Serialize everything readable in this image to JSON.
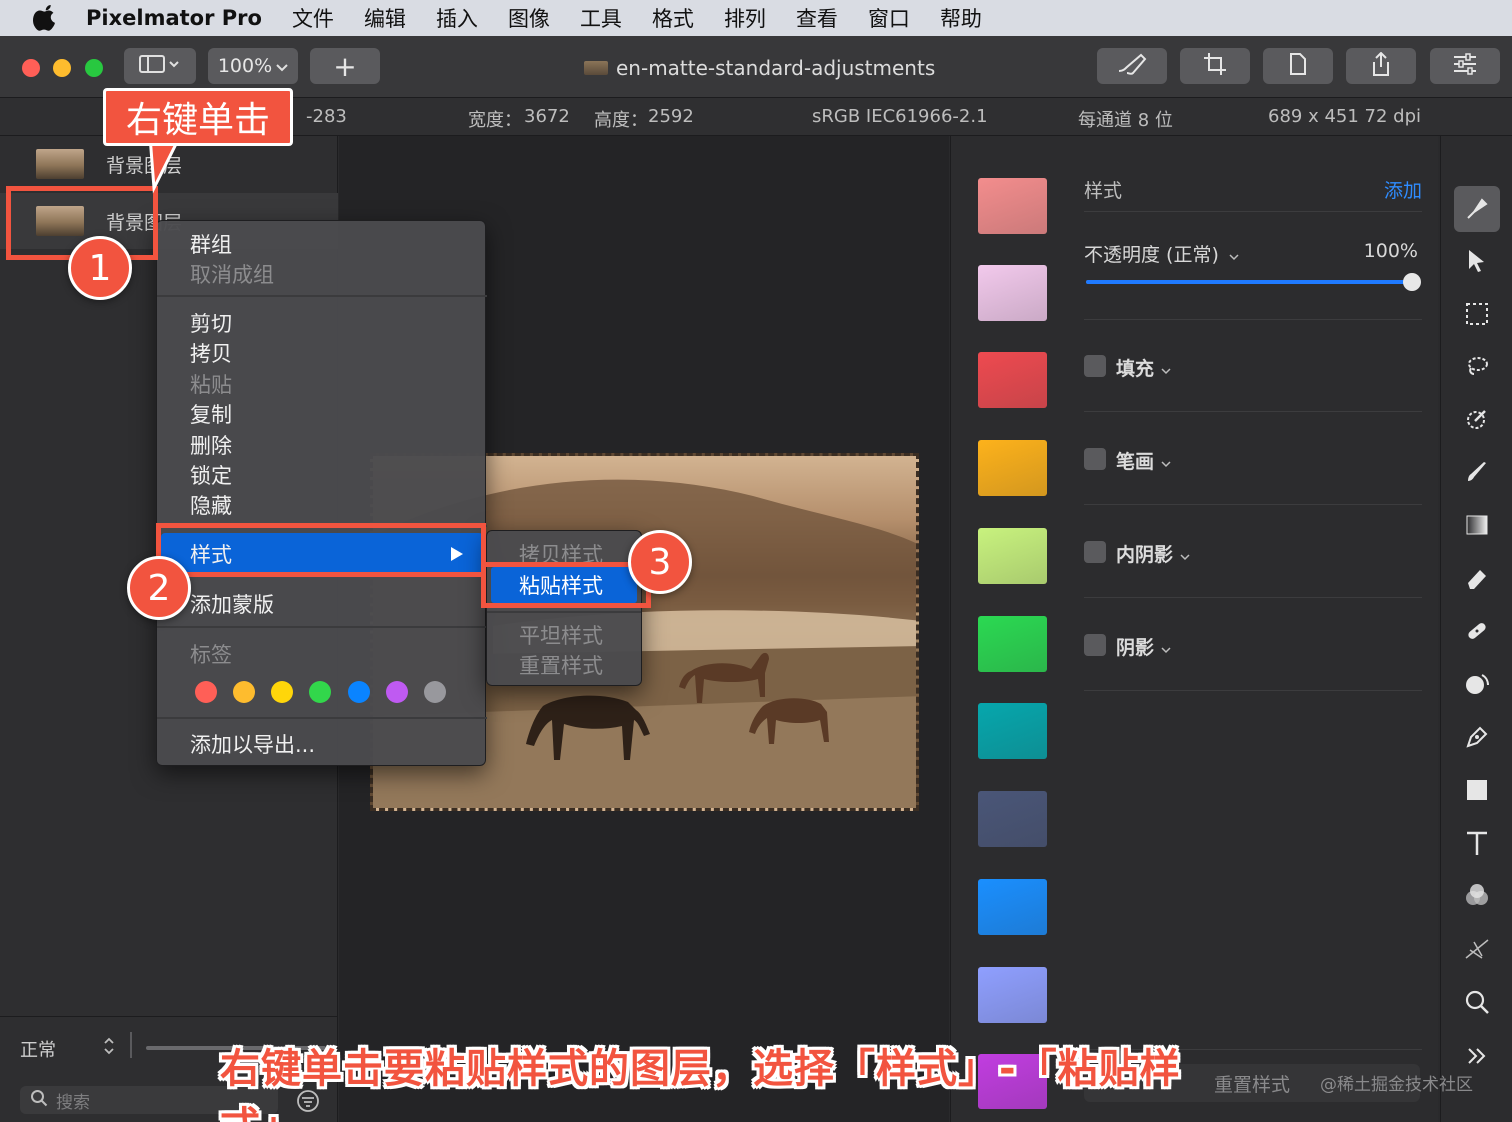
{
  "menubar": {
    "app_name": "Pixelmator Pro",
    "items": [
      "文件",
      "编辑",
      "插入",
      "图像",
      "工具",
      "格式",
      "排列",
      "查看",
      "窗口",
      "帮助"
    ]
  },
  "toolbar": {
    "zoom": "100%",
    "add_label": "+",
    "document_title": "en-matte-standard-adjustments",
    "traffic_lights": {
      "close": "#ff5f57",
      "minimize": "#febc2e",
      "zoom": "#28c840"
    }
  },
  "infobar": {
    "coord": "-283",
    "width_label": "宽度：",
    "width_value": "3672",
    "height_label": "高度：",
    "height_value": "2592",
    "color_profile": "sRGB IEC61966-2.1",
    "bit_depth": "每通道 8 位",
    "resolution": "689 x 451 72 dpi"
  },
  "layers": {
    "items": [
      {
        "name": "背景图层"
      },
      {
        "name": "背景图层"
      }
    ],
    "blend_mode": "正常",
    "search_placeholder": "搜索"
  },
  "context_menu": {
    "items": {
      "group": "群组",
      "ungroup": "取消成组",
      "cut": "剪切",
      "copy": "拷贝",
      "paste": "粘贴",
      "duplicate": "复制",
      "delete": "删除",
      "lock": "锁定",
      "hide": "隐藏",
      "style": "样式",
      "add_mask": "添加蒙版",
      "tags": "标签",
      "add_to_export": "添加以导出..."
    },
    "tag_colors": [
      "#ff5f57",
      "#febc2e",
      "#ffd60a",
      "#32d74b",
      "#0a84ff",
      "#bf5af2",
      "#98989d"
    ]
  },
  "style_submenu": {
    "copy_style": "拷贝样式",
    "paste_style": "粘贴样式",
    "flatten_style": "平坦样式",
    "reset_style": "重置样式"
  },
  "styles_panel": {
    "title": "样式",
    "add_label": "添加",
    "opacity_label": "不透明度 (正常)",
    "opacity_value": "100%",
    "opacity_level": 1.0,
    "effects": [
      "填充",
      "笔画",
      "内阴影",
      "阴影"
    ],
    "reset_style": "重置样式",
    "swatches": [
      "#f38d8d",
      "#f2c9ec",
      "#ee4a50",
      "#fdb21b",
      "#c8f27e",
      "#2bd952",
      "#06a7ad",
      "#4a5678",
      "#1a8fff",
      "#8f9fff",
      "#c13de0"
    ]
  },
  "tools": [
    "style-tool-icon",
    "arrow-icon",
    "selection-icon",
    "lasso-icon",
    "color-picker-icon",
    "brush-icon",
    "gradient-icon",
    "eraser-icon",
    "repair-icon",
    "distort-icon",
    "pen-icon",
    "shape-icon",
    "text-icon",
    "color-adjust-icon",
    "sharpen-icon",
    "zoom-icon"
  ],
  "annotations": {
    "callout": "右键单击",
    "step1": "1",
    "step2": "2",
    "step3": "3",
    "caption": "右键单击要粘贴样式的图层，选择「样式」-「粘贴样式」",
    "accent_color": "#f2543f"
  },
  "watermark": "@稀土掘金技术社区"
}
